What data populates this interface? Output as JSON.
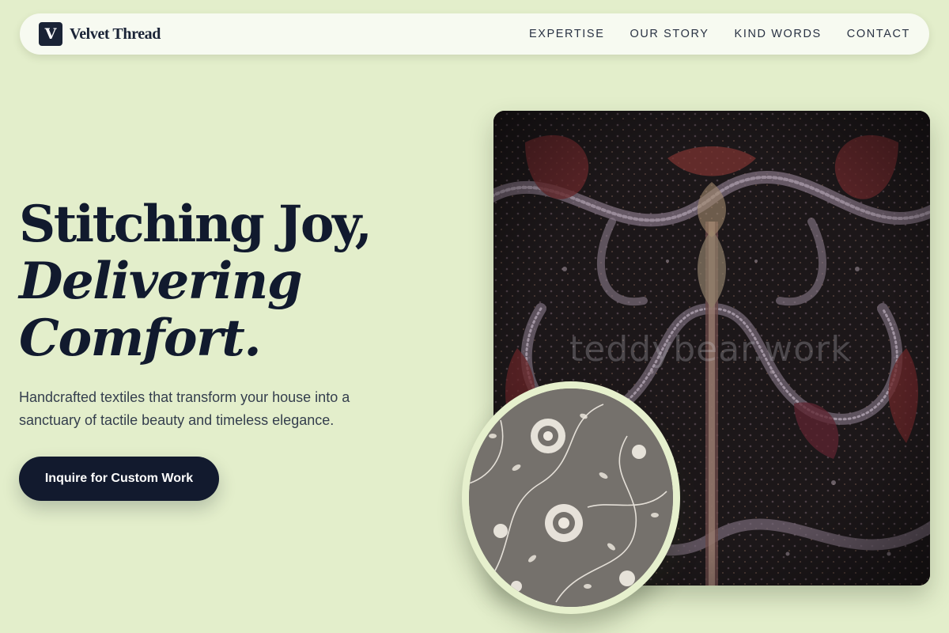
{
  "brand": {
    "logo_letter": "V",
    "name": "Velvet Thread"
  },
  "nav": {
    "links": [
      "EXPERTISE",
      "OUR STORY",
      "KIND WORDS",
      "CONTACT"
    ]
  },
  "hero": {
    "headline_line1": "Stitching Joy,",
    "headline_line2": "Delivering",
    "headline_line3": "Comfort.",
    "subtitle": "Handcrafted textiles that transform your house into a sanctuary of tactile beauty and timeless elegance.",
    "cta_label": "Inquire for Custom Work"
  },
  "images": {
    "main_watermark": "teddybear.work",
    "main_icon": "paisley-shawl-fabric",
    "circle_icon": "floral-linen-fabric"
  },
  "colors": {
    "background": "#e3eecb",
    "navy": "#121a2e",
    "nav_bg": "#f7faf1"
  }
}
